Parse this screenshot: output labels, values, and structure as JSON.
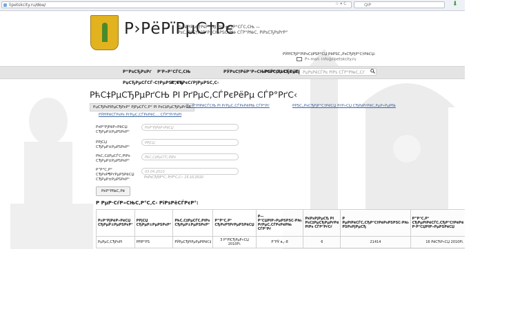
{
  "browser": {
    "url_domain": "lipetskcity.ru",
    "url_path": "/dou/",
    "nav_icons": "☆ ▾ C",
    "search_placeholder": "QIP"
  },
  "header": {
    "site_title": "Р›РёРїРµС†Рє",
    "site_subtitle": "Р›РёРїРµС†РєР°СЏ РѕР±Р»Р°СЃС‚СЊ — РѕС„РёС†РёР°Р»СЊРЅС‹Р№ СЃР°Р№С‚ РіРѕСЂРѕРґР°",
    "contact_line1": "РЎРїСЂР°РІРѕС‡РЅР°СЏ РёРЅС„РѕСЂРјР°С†РёСЏ:",
    "contact_line2": "Р•-mail: info@lipetskcity.ru"
  },
  "menu": {
    "items": [
      "Р“РѕСЂРѕРґ",
      "Р’Р»Р°СЃС‚СЊ",
      "РЎРѕС†РёР°Р»СЊРЅР°СЏ СЃС„РµСЂР°",
      "РСЃС‚РѕСЂРёСЏ",
      "РќРѕРІРѕСЃС‚Рё"
    ],
    "row2": [
      "РџСЂРµСЃСЃ-С†РµРЅС‚СЂ",
      "Р”РѕРєСѓРјРµРЅС‚С‹"
    ],
    "search_placeholder": "РџРѕРёСЃРє РїРѕ СЃР°Р№С‚Сѓ"
  },
  "page": {
    "heading": "РћС‡РµСЂРµРґСЊ РІ РґРµС‚СЃРєРёРµ СЃР°РґС‹",
    "tabs": [
      "РџСЂРѕРІРµСЂРєР° РјРµСЃС‚Р° РІ РѕС‡РµСЂРµРґРё",
      "Р—Р°РїРёСЃСЊ РІ РґРµС‚СЃРєРёР№ СЃР°Рґ",
      "РРЅС„РѕСЂРјР°С†РёСЏ РґР»СЏ СЂРѕРґРёС‚РµР»РµР№",
      "РЎРїРёСЃРѕРє РґРµС‚СЃРєРёС… СЃР°РґРѕРІ"
    ]
  },
  "form": {
    "fields": [
      {
        "label": "Р¤Р°РјРёР»РёСЏ СЂРµР±РµРЅРєР°",
        "placeholder": "Р¤Р°РјРёР»РёСЏ"
      },
      {
        "label": "РРјСЏ СЂРµР±РµРЅРєР°",
        "placeholder": "РРјСЏ"
      },
      {
        "label": "РћС‚С‡РµСЃС‚РІРѕ СЂРµР±РµРЅРєР°",
        "placeholder": "РћС‚С‡РµСЃС‚РІРѕ"
      },
      {
        "label": "Р”Р°С‚Р° СЂРѕР¶РґРµРЅРёСЏ СЂРµР±РµРЅРєР°",
        "placeholder": "03.04.2010"
      }
    ],
    "date_hint": "Р¤РѕСЂРјР°С‚ РґР°С‚С‹: 15.10.2010",
    "submit_label": "РќР°Р№С‚Рё"
  },
  "results": {
    "title": "Р РµР·СѓР»СЊС‚Р°С‚С‹ РїРѕРёСЃРєР°:",
    "columns": [
      "Р¤Р°РјРёР»РёСЏ СЂРµР±РµРЅРєР°",
      "РРјСЏ СЂРµР±РµРЅРєР°",
      "РћС‚С‡РµСЃС‚РІРѕ СЂРµР±РµРЅРєР°",
      "Р”Р°С‚Р° СЂРѕР¶РґРµРЅРёСЏ",
      "Р—Р°СЏРІР»РµРЅРЅС‹Р№ РґРµС‚СЃРєРёР№ СЃР°Рґ",
      "РќРѕРјРµСЂ РІ РѕС‡РµСЂРµРґРё РїРѕ СЃР°РґСѓ",
      "Р РµРіРёСЃС‚СЂР°С†РёРѕРЅРЅС‹Р№ РЅРѕРјРµСЂ",
      "Р”Р°С‚Р° СЂРµРіРёСЃС‚СЂР°С†РёРё Р·Р°СЏРІР»РµРЅРёСЏ"
    ],
    "rows": [
      [
        "РџРµС‚СЂРѕРІ",
        "РРІР°РЅ",
        "РЎРµСЂРіРµРµРІРёС‡",
        "3 Р°РїСЂРµР»СЏ 2010Рі.",
        "Р”РЎ в„–8",
        "6",
        "21414",
        "16 РёСЋР»СЏ 2010Рі."
      ]
    ]
  }
}
